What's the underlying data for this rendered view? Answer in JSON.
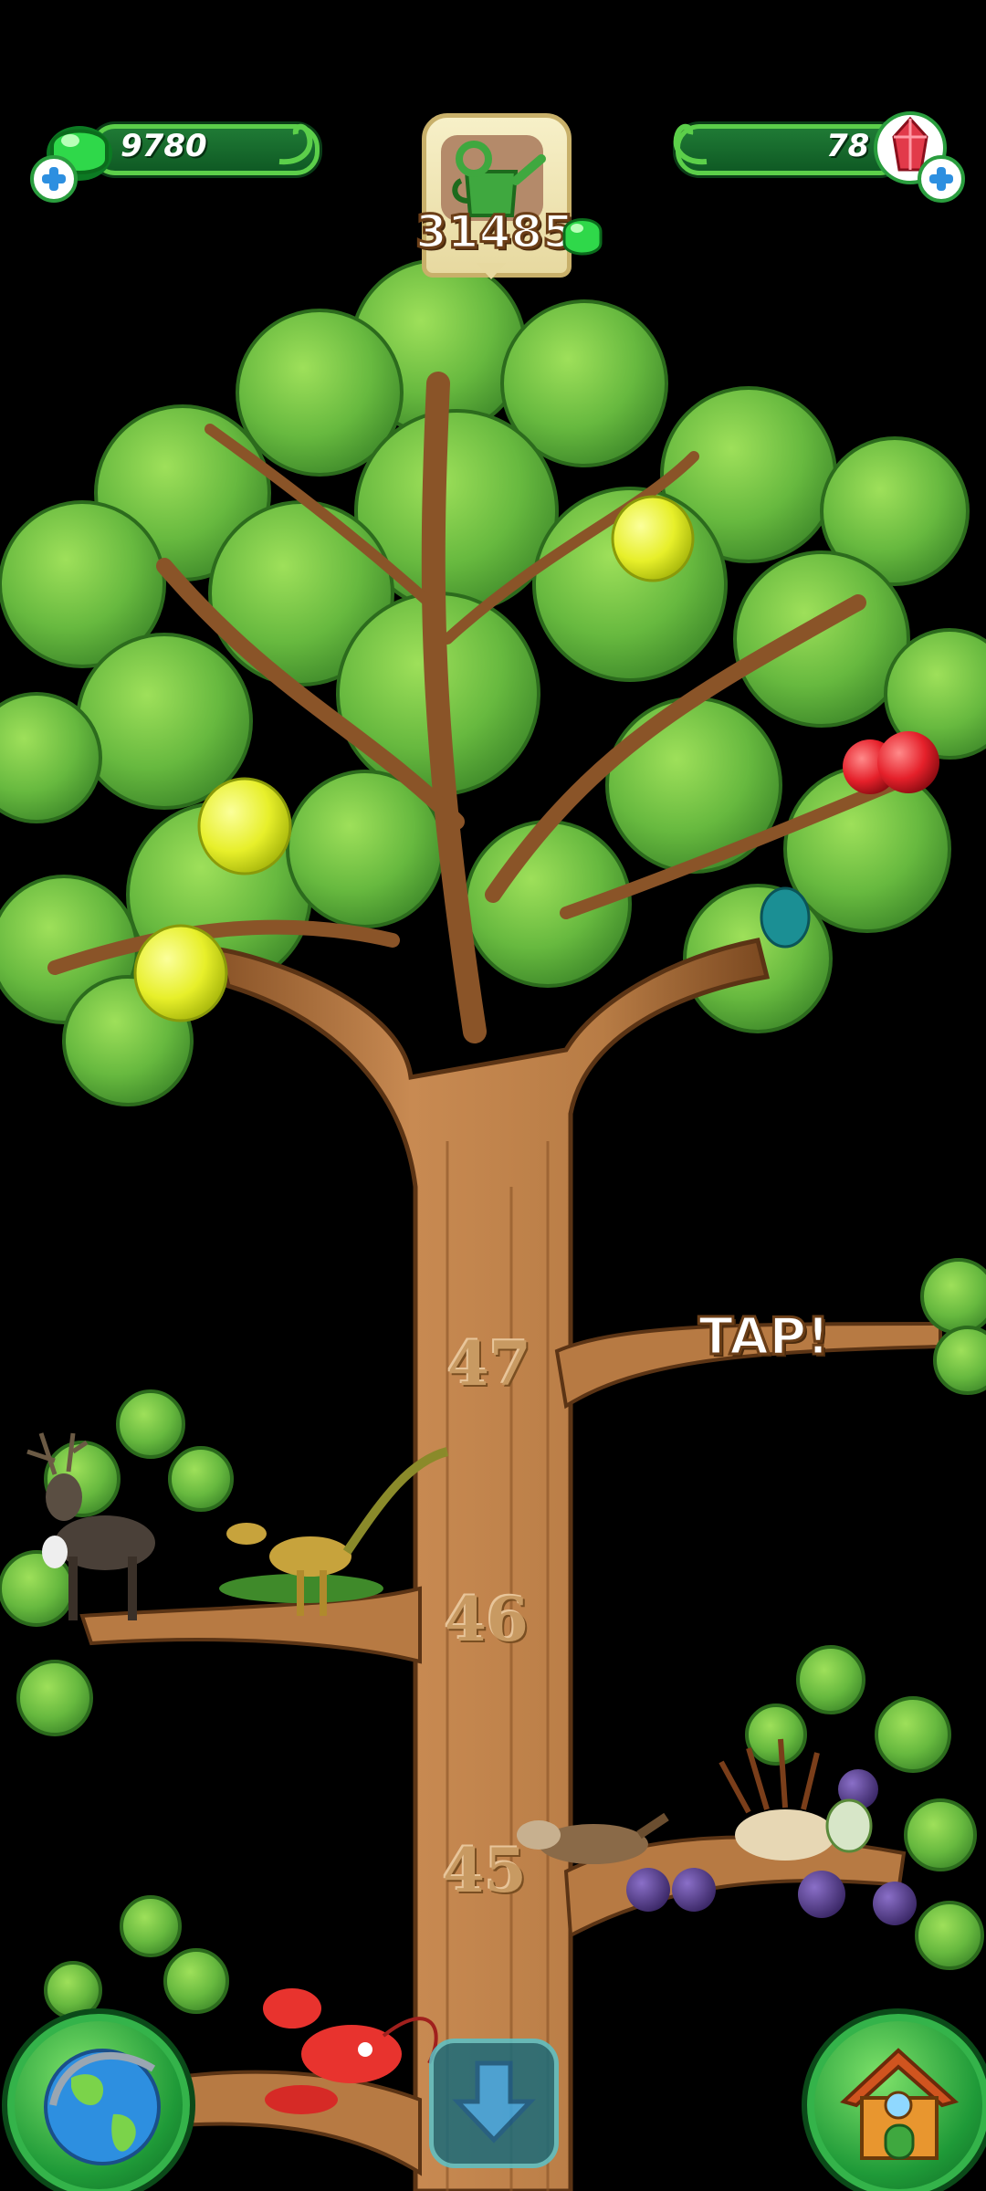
{
  "hud": {
    "gems": "9780",
    "crystals": "78",
    "water_score": "31485"
  },
  "tree": {
    "levels": [
      "47",
      "46",
      "45"
    ],
    "tap_label": "TAP!"
  },
  "icons": {
    "gem": "green-gem-icon",
    "crystal": "red-crystal-icon",
    "watering_can": "watering-can-icon",
    "globe": "globe-icon",
    "house": "house-icon",
    "scroll_down": "down-arrow-icon"
  },
  "colors": {
    "hud_bar": "#1f7a35",
    "hud_border": "#5ccf4a",
    "trunk": "#b97f48",
    "leaf": "#6cc24a"
  }
}
